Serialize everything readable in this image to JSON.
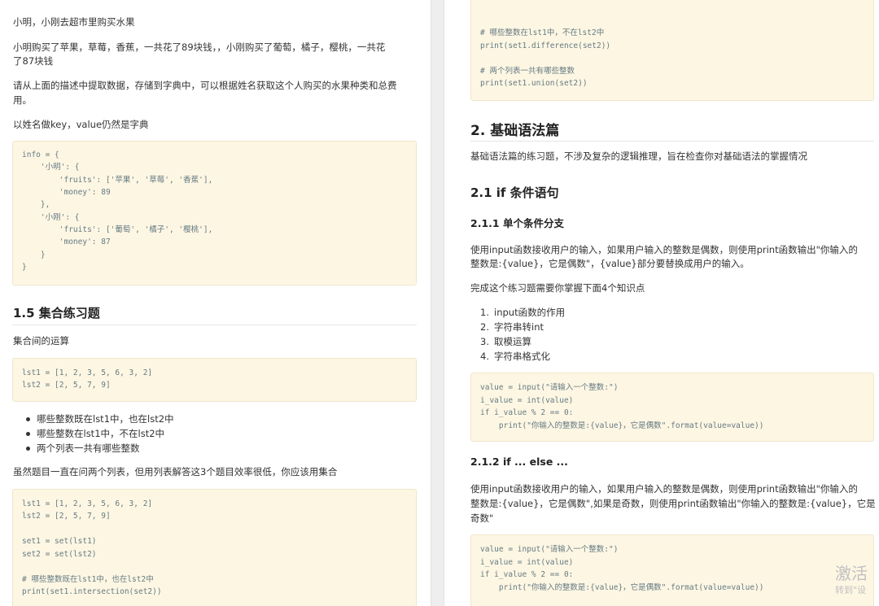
{
  "left": {
    "p1": "小明，小刚去超市里购买水果",
    "p2a": "小明购买了苹果，草莓，香蕉，一共花了89块钱，，小刚购买了葡萄，橘子，樱桃，一共花",
    "p2b": "了87块钱",
    "p3a": "请从上面的描述中提取数据，存储到字典中，可以根据姓名获取这个人购买的水果种类和总费",
    "p3b": "用。",
    "p4": "以姓名做key，value仍然是字典",
    "code1": [
      "info = {",
      "    '小明': {",
      "        'fruits': ['苹果', '草莓', '香蕉'],",
      "        'money': 89",
      "    },",
      "    '小刚': {",
      "        'fruits': ['葡萄', '橘子', '樱桃'],",
      "        'money': 87",
      "    }",
      "}"
    ],
    "heading_15": "1.5 集合练习题",
    "p5": "集合间的运算",
    "code2": [
      "lst1 = [1, 2, 3, 5, 6, 3, 2]",
      "lst2 = [2, 5, 7, 9]"
    ],
    "bullets": [
      "哪些整数既在lst1中，也在lst2中",
      "哪些整数在lst1中，不在lst2中",
      "两个列表一共有哪些整数"
    ],
    "p6": "虽然题目一直在问两个列表，但用列表解答这3个题目效率很低，你应该用集合",
    "code3": [
      "lst1 = [1, 2, 3, 5, 6, 3, 2]",
      "lst2 = [2, 5, 7, 9]",
      "",
      "set1 = set(lst1)",
      "set2 = set(lst2)",
      "",
      "# 哪些整数既在lst1中，也在lst2中",
      "print(set1.intersection(set2))"
    ]
  },
  "right": {
    "code_top": [
      "# 哪些整数在lst1中，不在lst2中",
      "print(set1.difference(set2))",
      "",
      "# 两个列表一共有哪些整数",
      "print(set1.union(set2))"
    ],
    "heading_2": "2. 基础语法篇",
    "p_intro": "基础语法篇的练习题，不涉及复杂的逻辑推理，旨在检查你对基础语法的掌握情况",
    "heading_21": "2.1 if 条件语句",
    "heading_211": "2.1.1 单个条件分支",
    "p_211a": "使用input函数接收用户的输入，如果用户输入的整数是偶数，则使用print函数输出\"你输入的",
    "p_211b": "整数是:{value}，它是偶数\"，{value}部分要替换成用户的输入。",
    "p_211c": "完成这个练习题需要你掌握下面4个知识点",
    "ol": [
      "input函数的作用",
      "字符串转int",
      "取模运算",
      "字符串格式化"
    ],
    "code_a": [
      "value = input(\"请输入一个整数:\")",
      "i_value = int(value)",
      "if i_value % 2 == 0:",
      "    print(\"你输入的整数是:{value}，它是偶数\".format(value=value))"
    ],
    "heading_212": "2.1.2 if ... else ...",
    "p_212a": "使用input函数接收用户的输入，如果用户输入的整数是偶数，则使用print函数输出\"你输入的",
    "p_212b": "整数是:{value}，它是偶数\",如果是奇数，则使用print函数输出\"你输入的整数是:{value}，它是",
    "p_212c": "奇数\"",
    "code_b": [
      "value = input(\"请输入一个整数:\")",
      "i_value = int(value)",
      "if i_value % 2 == 0:",
      "    print(\"你输入的整数是:{value}，它是偶数\".format(value=value))"
    ]
  },
  "watermark": {
    "line1": "激活",
    "line2": "转到\"设"
  }
}
